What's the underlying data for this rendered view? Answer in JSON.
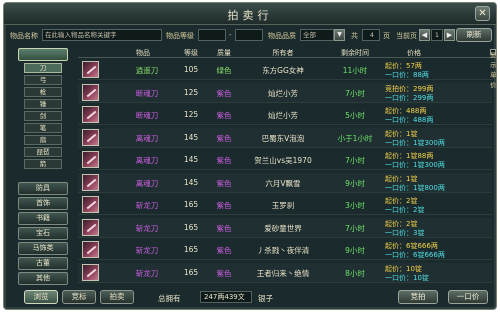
{
  "title": "拍卖行",
  "colors": {
    "purple_name": "#cf5ee6",
    "green_name": "#8be06a",
    "purple_quality": "#cf5ee6",
    "green_quality": "#8be06a",
    "time": "#6fe36a",
    "price_start": "#f6d44a",
    "price_buyout": "#4fe0e6"
  },
  "search": {
    "name_label": "物品名称",
    "name_placeholder": "在此输入物品名称关键字",
    "level_label": "物品等级",
    "level_from": "",
    "level_sep": "-",
    "level_to": "",
    "quality_label": "物品品质",
    "quality_value": "全部",
    "total_label": "共",
    "total_pages": "4",
    "pages_unit": "页",
    "current_label": "当前页",
    "current_page": "1",
    "refresh_label": "刷新"
  },
  "sidebar": {
    "categories": [
      {
        "label": "",
        "active": true
      },
      {
        "label": "防具",
        "active": false
      },
      {
        "label": "首饰",
        "active": false
      },
      {
        "label": "书籍",
        "active": false
      },
      {
        "label": "宝石",
        "active": false
      },
      {
        "label": "马饰类",
        "active": false
      },
      {
        "label": "古董",
        "active": false
      },
      {
        "label": "其他",
        "active": false
      }
    ],
    "subcategories": [
      {
        "label": "刀",
        "active": true
      },
      {
        "label": "弓",
        "active": false
      },
      {
        "label": "枪",
        "active": false
      },
      {
        "label": "锤",
        "active": false
      },
      {
        "label": "剑",
        "active": false
      },
      {
        "label": "笔",
        "active": false
      },
      {
        "label": "扇",
        "active": false
      },
      {
        "label": "琵琶",
        "active": false
      },
      {
        "label": "箭",
        "active": false
      }
    ]
  },
  "table": {
    "headers": {
      "item": "物品",
      "level": "等级",
      "quality": "质量",
      "owner": "所有者",
      "time": "剩余时间",
      "price": "价格",
      "show_unit_price": "显示单价"
    },
    "rows": [
      {
        "name": "逍遥刀",
        "name_color": "green",
        "level": "105",
        "quality": "绿色",
        "quality_color": "green",
        "owner": "东方GG女神",
        "time": "11小时",
        "start": "起价：57两",
        "buyout": "一口价：88两"
      },
      {
        "name": "断魂刀",
        "name_color": "purple",
        "level": "125",
        "quality": "紫色",
        "quality_color": "purple",
        "owner": "灿烂小芳",
        "time": "7小时",
        "start": "竞拍价：299两",
        "buyout": "一口价：299两"
      },
      {
        "name": "断魂刀",
        "name_color": "purple",
        "level": "125",
        "quality": "紫色",
        "quality_color": "purple",
        "owner": "灿烂小芳",
        "time": "5小时",
        "start": "起价：488两",
        "buyout": "一口价：488两"
      },
      {
        "name": "离魂刀",
        "name_color": "purple",
        "level": "145",
        "quality": "紫色",
        "quality_color": "purple",
        "owner": "巴蜀东V泡泡",
        "time": "小于1小时",
        "start": "起价：1锭",
        "buyout": "一口价：1锭300两"
      },
      {
        "name": "离魂刀",
        "name_color": "purple",
        "level": "145",
        "quality": "紫色",
        "quality_color": "purple",
        "owner": "贺兰山vs吴1970",
        "time": "7小时",
        "start": "起价：1锭88两",
        "buyout": "一口价：1锭300两"
      },
      {
        "name": "离魂刀",
        "name_color": "purple",
        "level": "145",
        "quality": "紫色",
        "quality_color": "purple",
        "owner": "六月V飘雪",
        "time": "9小时",
        "start": "起价：1锭",
        "buyout": "一口价：1锭800两"
      },
      {
        "name": "斩龙刀",
        "name_color": "purple",
        "level": "165",
        "quality": "紫色",
        "quality_color": "purple",
        "owner": "玉罗刹",
        "time": "3小时",
        "start": "起价：2锭",
        "buyout": "一口价：2锭"
      },
      {
        "name": "斩龙刀",
        "name_color": "purple",
        "level": "165",
        "quality": "紫色",
        "quality_color": "purple",
        "owner": "爱砂童世界",
        "time": "7小时",
        "start": "起价：2锭",
        "buyout": "一口价：3锭"
      },
      {
        "name": "斩龙刀",
        "name_color": "purple",
        "level": "165",
        "quality": "紫色",
        "quality_color": "purple",
        "owner": "丿杀戮丶夜伴清",
        "time": "9小时",
        "start": "起价：6锭666两",
        "buyout": "一口价：6锭666两"
      },
      {
        "name": "斩龙刀",
        "name_color": "purple",
        "level": "165",
        "quality": "紫色",
        "quality_color": "purple",
        "owner": "王者归来丶绝情",
        "time": "8小时",
        "start": "起价：10锭",
        "buyout": "一口价：10锭"
      }
    ]
  },
  "bottom": {
    "tabs": [
      {
        "label": "浏览",
        "active": true
      },
      {
        "label": "竞标",
        "active": false
      },
      {
        "label": "拍卖",
        "active": false
      }
    ],
    "money_label": "总拥有",
    "money_value": "247两439文",
    "money_unit": "银子",
    "bid_label": "竞拍",
    "buyout_label": "一口价"
  }
}
